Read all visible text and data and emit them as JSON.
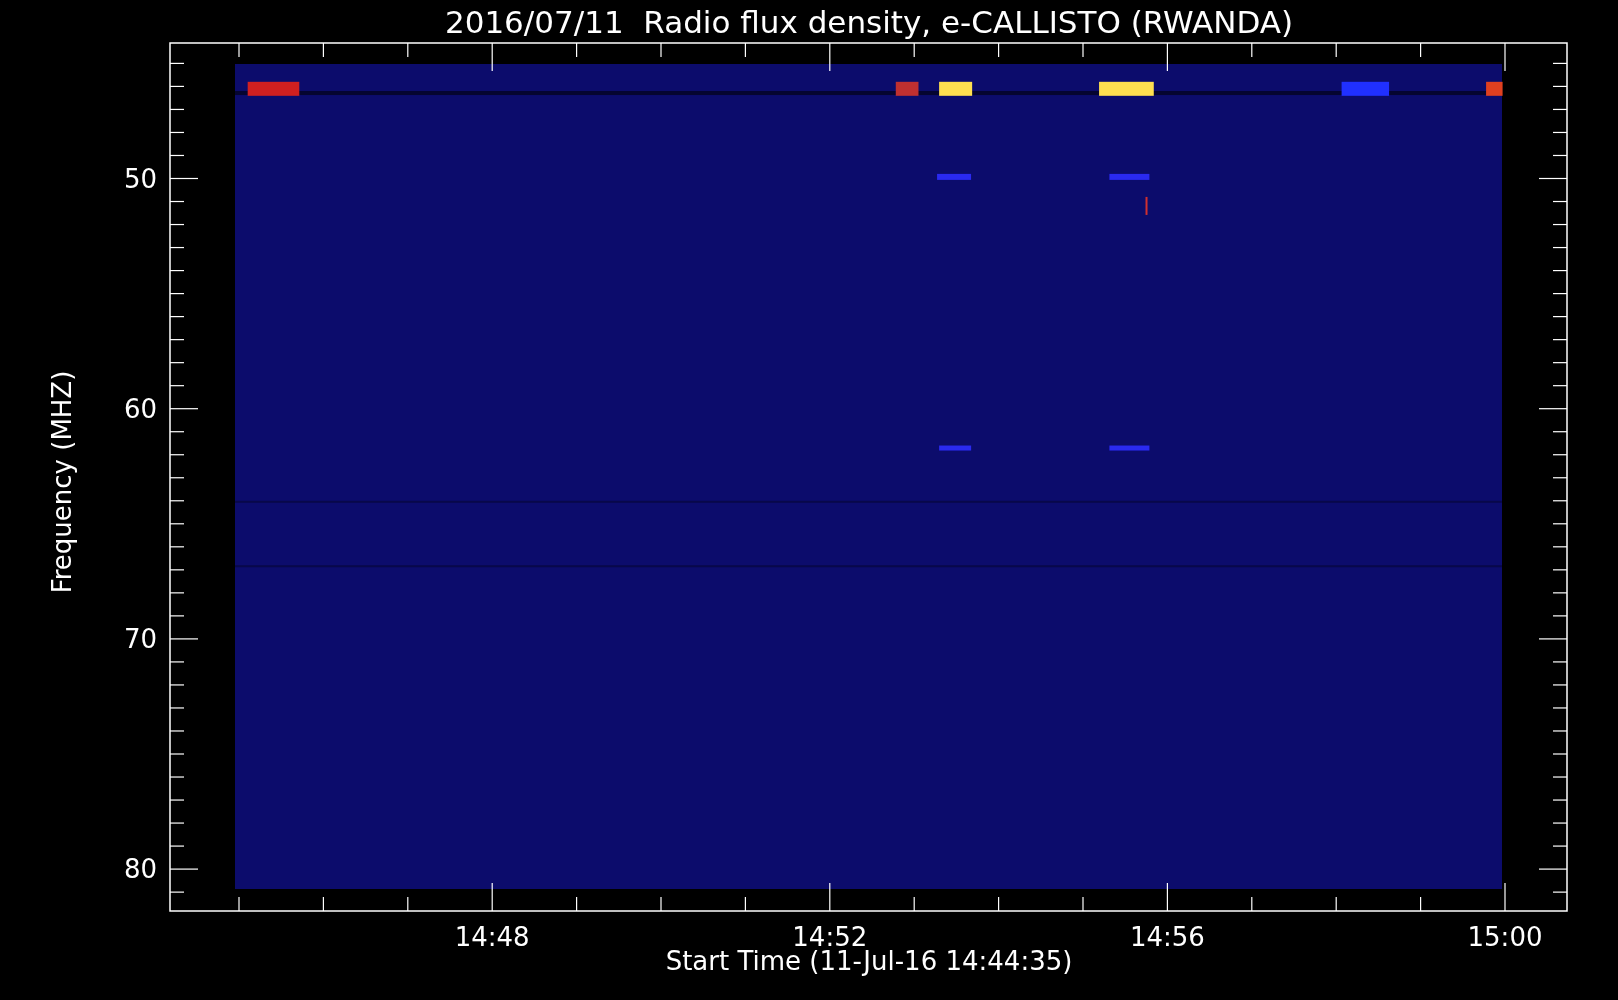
{
  "title": "2016/07/11  Radio flux density, e-CALLISTO (RWANDA)",
  "y_axis": {
    "label": "Frequency (MHZ)",
    "ticks": [
      "50",
      "60",
      "70",
      "80"
    ]
  },
  "x_axis": {
    "label": "Start Time (11-Jul-16 14:44:35)",
    "ticks": [
      "14:48",
      "14:52",
      "14:56",
      "15:00"
    ]
  }
}
